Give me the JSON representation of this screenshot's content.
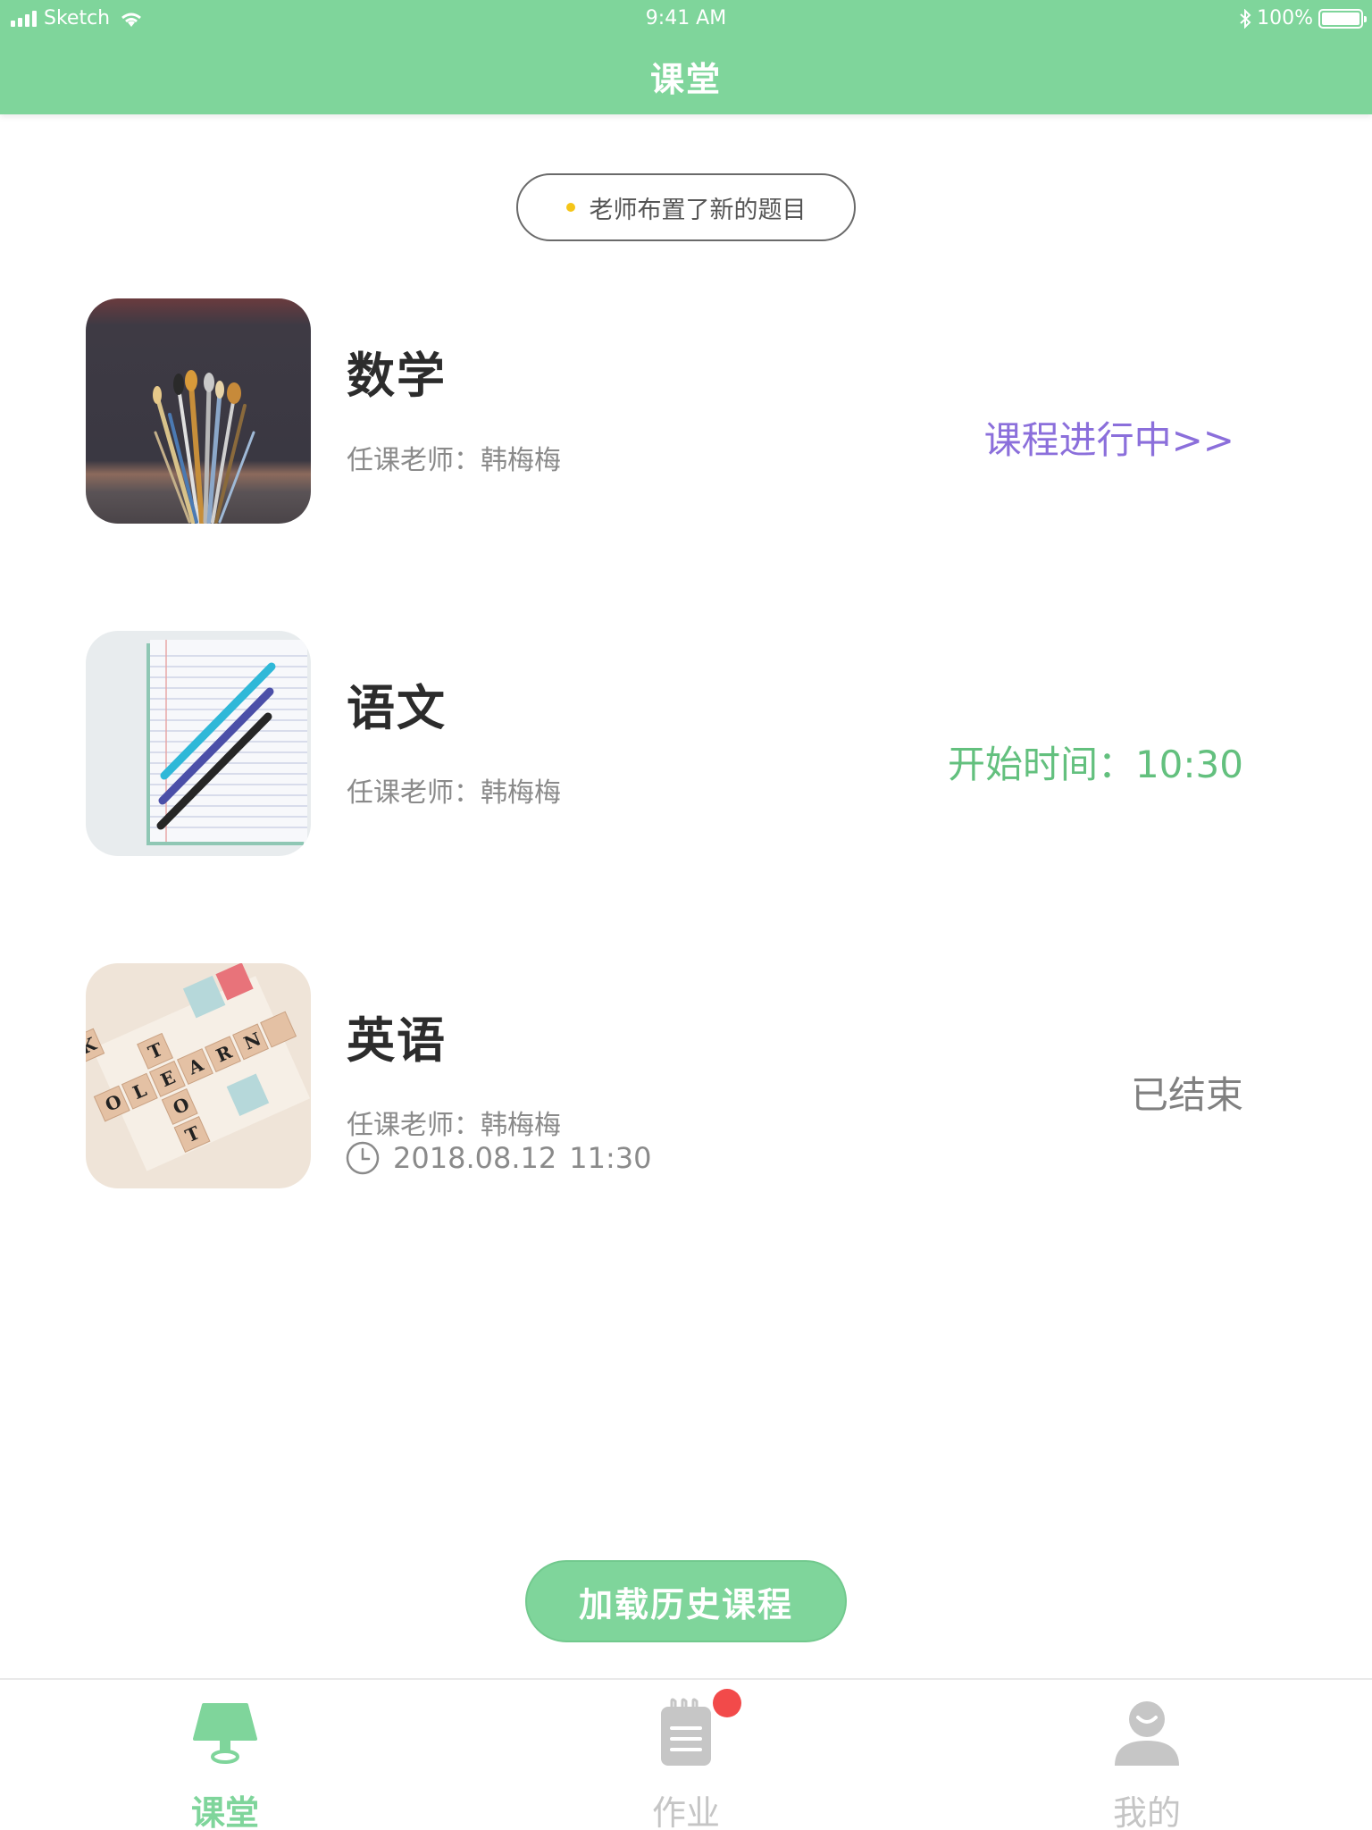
{
  "status_bar": {
    "carrier": "Sketch",
    "time": "9:41 AM",
    "battery": "100%"
  },
  "header": {
    "title": "课堂"
  },
  "notice": {
    "text": "老师布置了新的题目"
  },
  "courses": [
    {
      "name": "数学",
      "teacher": "任课老师：韩梅梅",
      "status": "课程进行中>>",
      "image_icon": "paint-brushes-photo"
    },
    {
      "name": "语文",
      "teacher": "任课老师：韩梅梅",
      "status": "开始时间：10:30",
      "image_icon": "notebook-pens-photo"
    },
    {
      "name": "英语",
      "teacher": "任课老师：韩梅梅",
      "date": "2018.08.12",
      "time": "11:30",
      "status": "已结束",
      "image_icon": "scrabble-tiles-photo"
    }
  ],
  "load_history_label": "加载历史课程",
  "tabs": [
    {
      "label": "课堂",
      "icon": "lamp-icon",
      "active": true
    },
    {
      "label": "作业",
      "icon": "notepad-icon",
      "active": false,
      "badge": true
    },
    {
      "label": "我的",
      "icon": "person-icon",
      "active": false
    }
  ],
  "colors": {
    "primary_green": "#7fd59b",
    "live_purple": "#8b6fdb",
    "start_green": "#63c07e",
    "ended_gray": "#808080",
    "badge_red": "#f24a4a"
  }
}
